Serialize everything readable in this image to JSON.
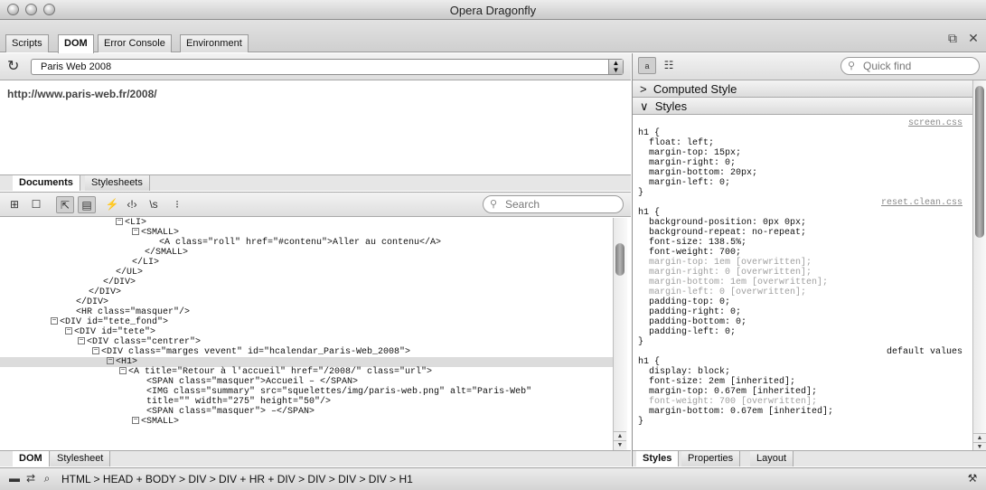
{
  "window": {
    "title": "Opera Dragonfly"
  },
  "tabs": [
    {
      "label": "Scripts",
      "active": false
    },
    {
      "label": "DOM",
      "active": true
    },
    {
      "label": "Error Console",
      "active": false
    },
    {
      "label": "Environment",
      "active": false
    }
  ],
  "documents": {
    "selected": "Paris Web 2008",
    "url": "http://www.paris-web.fr/2008/",
    "subtabs": [
      "Documents",
      "Stylesheets"
    ]
  },
  "dom_toolbar": {
    "search_placeholder": "Search"
  },
  "dom_tree": [
    {
      "text": "<LI>",
      "toggle": "−"
    },
    {
      "text": "<SMALL>",
      "toggle": "−"
    },
    {
      "text": "<A class=\"roll\" href=\"#contenu\">Aller au contenu</A>",
      "toggle": ""
    },
    {
      "text": "</SMALL>",
      "toggle": ""
    },
    {
      "text": "</LI>",
      "toggle": ""
    },
    {
      "text": "</UL>",
      "toggle": ""
    },
    {
      "text": "</DIV>",
      "toggle": ""
    },
    {
      "text": "</DIV>",
      "toggle": ""
    },
    {
      "text": "</DIV>",
      "toggle": ""
    },
    {
      "text": "<HR class=\"masquer\"/>",
      "toggle": ""
    },
    {
      "text": "<DIV id=\"tete_fond\">",
      "toggle": "−"
    },
    {
      "text": "<DIV id=\"tete\">",
      "toggle": "−"
    },
    {
      "text": "<DIV class=\"centrer\">",
      "toggle": "−"
    },
    {
      "text": "<DIV class=\"marges vevent\" id=\"hcalendar_Paris-Web_2008\">",
      "toggle": "−"
    },
    {
      "text": "<H1>",
      "toggle": "−"
    },
    {
      "text": "<A title=\"Retour à l'accueil\" href=\"/2008/\" class=\"url\">",
      "toggle": "−"
    },
    {
      "text": "<SPAN class=\"masquer\">Accueil – </SPAN>",
      "toggle": ""
    },
    {
      "text": "<IMG class=\"summary\" src=\"squelettes/img/paris-web.png\" alt=\"Paris-Web\"",
      "toggle": ""
    },
    {
      "text": "title=\"\" width=\"275\" height=\"50\"/>",
      "toggle": ""
    },
    {
      "text": "<SPAN class=\"masquer\"> –</SPAN>",
      "toggle": ""
    },
    {
      "text": "<SMALL>",
      "toggle": "−"
    }
  ],
  "bottom_left_tabs": [
    "DOM",
    "Stylesheet"
  ],
  "right_panel": {
    "quick_find_placeholder": "Quick find",
    "computed_style_label": "Computed Style",
    "styles_label": "Styles",
    "computed_chevron": ">",
    "styles_chevron": "∨",
    "css": [
      {
        "kind": "source",
        "text": "screen.css"
      },
      {
        "kind": "text",
        "text": "h1 {"
      },
      {
        "kind": "text",
        "text": "  float: left;"
      },
      {
        "kind": "text",
        "text": "  margin-top: 15px;"
      },
      {
        "kind": "text",
        "text": "  margin-right: 0;"
      },
      {
        "kind": "text",
        "text": "  margin-bottom: 20px;"
      },
      {
        "kind": "text",
        "text": "  margin-left: 0;"
      },
      {
        "kind": "text",
        "text": "}"
      },
      {
        "kind": "source",
        "text": "reset.clean.css"
      },
      {
        "kind": "text",
        "text": "h1 {"
      },
      {
        "kind": "text",
        "text": "  background-position: 0px 0px;"
      },
      {
        "kind": "text",
        "text": "  background-repeat: no-repeat;"
      },
      {
        "kind": "text",
        "text": "  font-size: 138.5%;"
      },
      {
        "kind": "text",
        "text": "  font-weight: 700;"
      },
      {
        "kind": "ovr",
        "text": "  margin-top: 1em [overwritten];"
      },
      {
        "kind": "ovr",
        "text": "  margin-right: 0 [overwritten];"
      },
      {
        "kind": "ovr",
        "text": "  margin-bottom: 1em [overwritten];"
      },
      {
        "kind": "ovr",
        "text": "  margin-left: 0 [overwritten];"
      },
      {
        "kind": "text",
        "text": "  padding-top: 0;"
      },
      {
        "kind": "text",
        "text": "  padding-right: 0;"
      },
      {
        "kind": "text",
        "text": "  padding-bottom: 0;"
      },
      {
        "kind": "text",
        "text": "  padding-left: 0;"
      },
      {
        "kind": "text",
        "text": "}"
      },
      {
        "kind": "label",
        "text": "default values"
      },
      {
        "kind": "text",
        "text": "h1 {"
      },
      {
        "kind": "text",
        "text": "  display: block;"
      },
      {
        "kind": "text",
        "text": "  font-size: 2em [inherited];"
      },
      {
        "kind": "text",
        "text": "  margin-top: 0.67em [inherited];"
      },
      {
        "kind": "ovr",
        "text": "  font-weight: 700 [overwritten];"
      },
      {
        "kind": "text",
        "text": "  margin-bottom: 0.67em [inherited];"
      },
      {
        "kind": "text",
        "text": "}"
      }
    ],
    "bottom_tabs": [
      "Styles",
      "Properties",
      "Layout"
    ]
  },
  "statusbar": {
    "breadcrumb": "HTML > HEAD + BODY > DIV > DIV + HR + DIV > DIV > DIV > DIV > H1"
  }
}
